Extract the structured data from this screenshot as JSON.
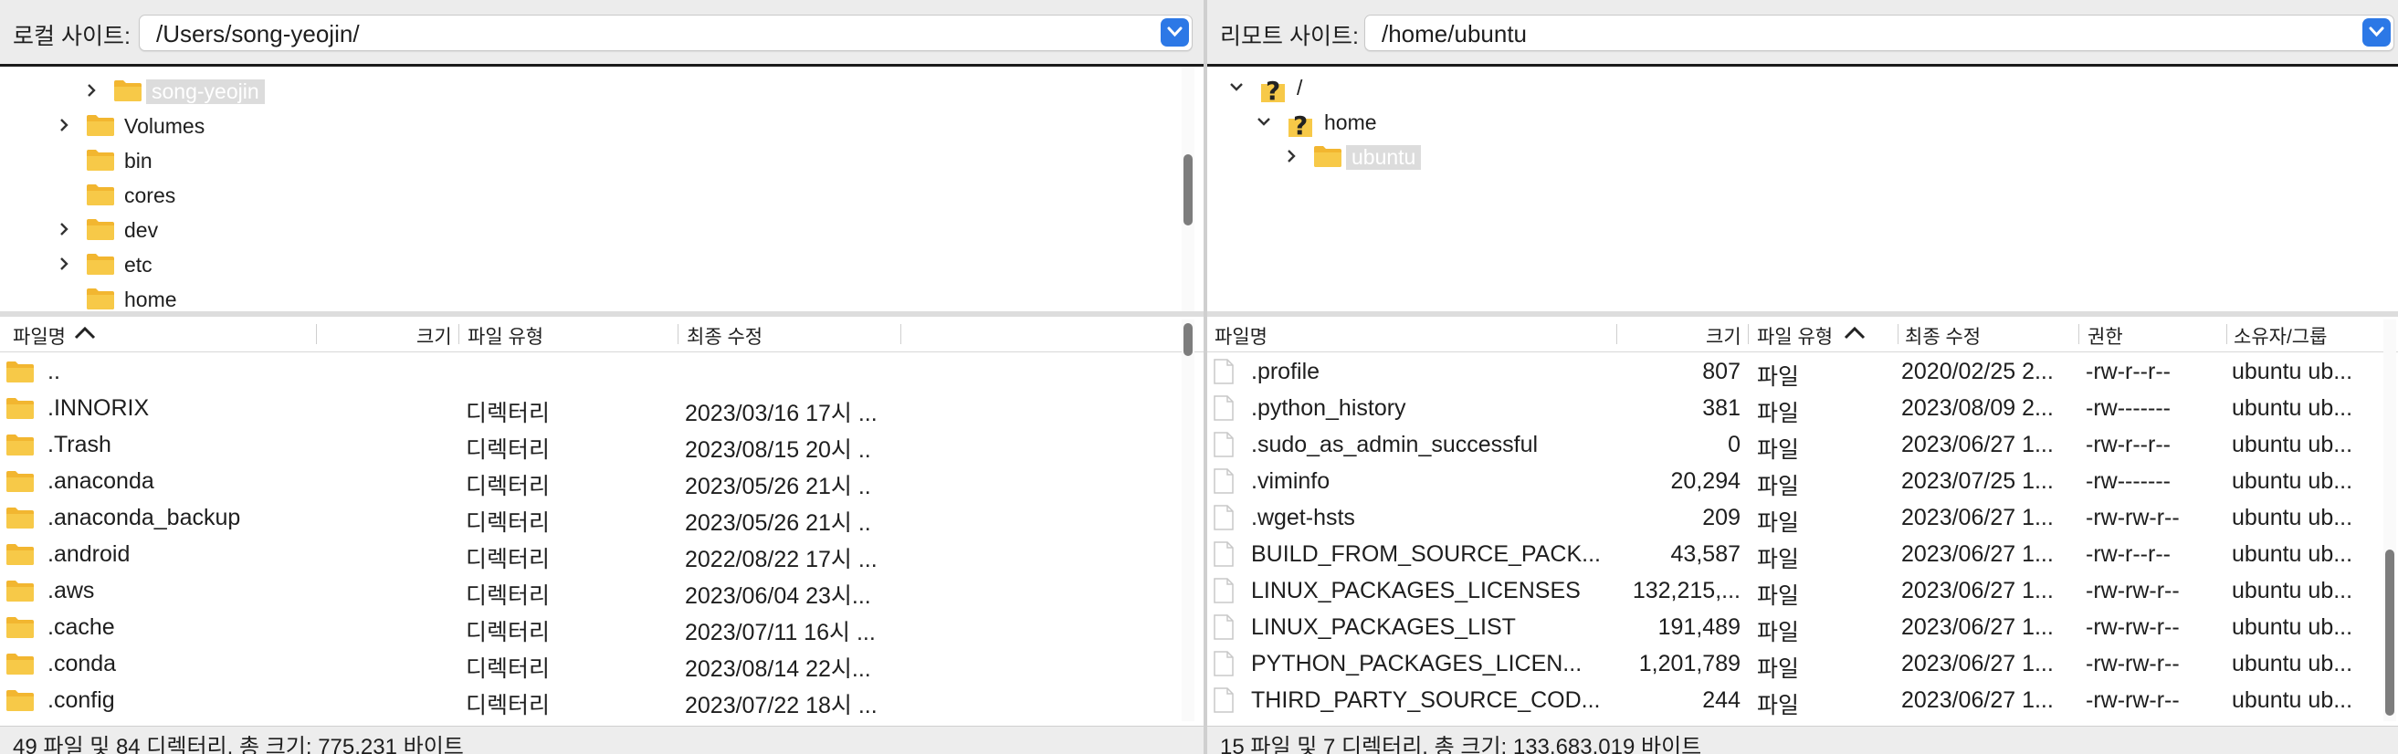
{
  "local": {
    "address_label": "로컬 사이트:",
    "path": "/Users/song-yeojin/",
    "tree": [
      {
        "label": "song-yeojin",
        "expander": "collapsed",
        "indent": 2,
        "selected": true
      },
      {
        "label": "Volumes",
        "expander": "collapsed",
        "indent": 1
      },
      {
        "label": "bin",
        "expander": "none",
        "indent": 1
      },
      {
        "label": "cores",
        "expander": "none",
        "indent": 1
      },
      {
        "label": "dev",
        "expander": "collapsed",
        "indent": 1
      },
      {
        "label": "etc",
        "expander": "collapsed",
        "indent": 1
      },
      {
        "label": "home",
        "expander": "none",
        "indent": 1
      }
    ],
    "columns": {
      "name": "파일명",
      "size": "크기",
      "type": "파일 유형",
      "modified": "최종 수정"
    },
    "files": [
      {
        "name": "..",
        "type": "",
        "modified": ""
      },
      {
        "name": ".INNORIX",
        "type": "디렉터리",
        "modified": "2023/03/16 17시 ..."
      },
      {
        "name": ".Trash",
        "type": "디렉터리",
        "modified": "2023/08/15 20시 .."
      },
      {
        "name": ".anaconda",
        "type": "디렉터리",
        "modified": "2023/05/26 21시 .."
      },
      {
        "name": ".anaconda_backup",
        "type": "디렉터리",
        "modified": "2023/05/26 21시 .."
      },
      {
        "name": ".android",
        "type": "디렉터리",
        "modified": "2022/08/22 17시 ..."
      },
      {
        "name": ".aws",
        "type": "디렉터리",
        "modified": "2023/06/04 23시..."
      },
      {
        "name": ".cache",
        "type": "디렉터리",
        "modified": "2023/07/11 16시 ..."
      },
      {
        "name": ".conda",
        "type": "디렉터리",
        "modified": "2023/08/14 22시..."
      },
      {
        "name": ".config",
        "type": "디렉터리",
        "modified": "2023/07/22 18시 ..."
      }
    ],
    "status": "49 파일 및 84 디렉터리. 총 크기: 775,231 바이트"
  },
  "remote": {
    "address_label": "리모트 사이트:",
    "path": "/home/ubuntu",
    "tree": [
      {
        "label": "/",
        "icon": "unknown",
        "expander": "expanded",
        "indent": 0
      },
      {
        "label": "home",
        "icon": "unknown",
        "expander": "expanded",
        "indent": 1
      },
      {
        "label": "ubuntu",
        "icon": "folder",
        "expander": "collapsed",
        "indent": 2,
        "selected": true
      }
    ],
    "columns": {
      "name": "파일명",
      "size": "크기",
      "type": "파일 유형",
      "modified": "최종 수정",
      "perms": "권한",
      "owner": "소유자/그룹"
    },
    "files": [
      {
        "name": ".profile",
        "size": "807",
        "type": "파일",
        "modified": "2020/02/25 2...",
        "perms": "-rw-r--r--",
        "owner": "ubuntu ub..."
      },
      {
        "name": ".python_history",
        "size": "381",
        "type": "파일",
        "modified": "2023/08/09 2...",
        "perms": "-rw-------",
        "owner": "ubuntu ub..."
      },
      {
        "name": ".sudo_as_admin_successful",
        "size": "0",
        "type": "파일",
        "modified": "2023/06/27 1...",
        "perms": "-rw-r--r--",
        "owner": "ubuntu ub..."
      },
      {
        "name": ".viminfo",
        "size": "20,294",
        "type": "파일",
        "modified": "2023/07/25 1...",
        "perms": "-rw-------",
        "owner": "ubuntu ub..."
      },
      {
        "name": ".wget-hsts",
        "size": "209",
        "type": "파일",
        "modified": "2023/06/27 1...",
        "perms": "-rw-rw-r--",
        "owner": "ubuntu ub..."
      },
      {
        "name": "BUILD_FROM_SOURCE_PACK...",
        "size": "43,587",
        "type": "파일",
        "modified": "2023/06/27 1...",
        "perms": "-rw-r--r--",
        "owner": "ubuntu ub..."
      },
      {
        "name": "LINUX_PACKAGES_LICENSES",
        "size": "132,215,...",
        "type": "파일",
        "modified": "2023/06/27 1...",
        "perms": "-rw-rw-r--",
        "owner": "ubuntu ub..."
      },
      {
        "name": "LINUX_PACKAGES_LIST",
        "size": "191,489",
        "type": "파일",
        "modified": "2023/06/27 1...",
        "perms": "-rw-rw-r--",
        "owner": "ubuntu ub..."
      },
      {
        "name": "PYTHON_PACKAGES_LICEN...",
        "size": "1,201,789",
        "type": "파일",
        "modified": "2023/06/27 1...",
        "perms": "-rw-rw-r--",
        "owner": "ubuntu ub..."
      },
      {
        "name": "THIRD_PARTY_SOURCE_COD...",
        "size": "244",
        "type": "파일",
        "modified": "2023/06/27 1...",
        "perms": "-rw-rw-r--",
        "owner": "ubuntu ub..."
      }
    ],
    "status": "15 파일 및 7 디렉터리. 총 크기: 133,683,019 바이트"
  },
  "colors": {
    "folder": "#f7c343",
    "accent": "#2c78e6",
    "selection": "#dcdcdc"
  }
}
